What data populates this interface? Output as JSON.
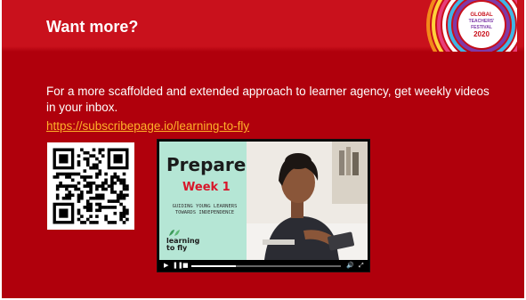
{
  "slide": {
    "title": "Want more?",
    "body": "For a more scaffolded and extended approach to learner agency, get weekly videos in your inbox.",
    "link_text": "https://subscribepage.io/learning-to-fly",
    "badge_lines": [
      "GLOBAL",
      "TEACHERS'",
      "FESTIVAL",
      "2020"
    ],
    "colors": {
      "background": "#b0000c",
      "header": "#c9111c",
      "link": "#ffb12a",
      "text": "#ffffff"
    }
  },
  "video": {
    "thumb_title": "Prepare",
    "thumb_week": "Week 1",
    "thumb_subtitle": "GUIDING YOUNG LEARNERS TOWARDS INDEPENDENCE",
    "brand_line1": "learning",
    "brand_line2": "to fly",
    "progress": 0.3,
    "controls": {
      "play_icon": "play-icon",
      "pause_icon": "pause-icon",
      "stop_icon": "stop-icon",
      "volume_icon": "volume-icon",
      "fullscreen_icon": "fullscreen-icon"
    }
  },
  "qr": {
    "icon": "qr-code"
  }
}
